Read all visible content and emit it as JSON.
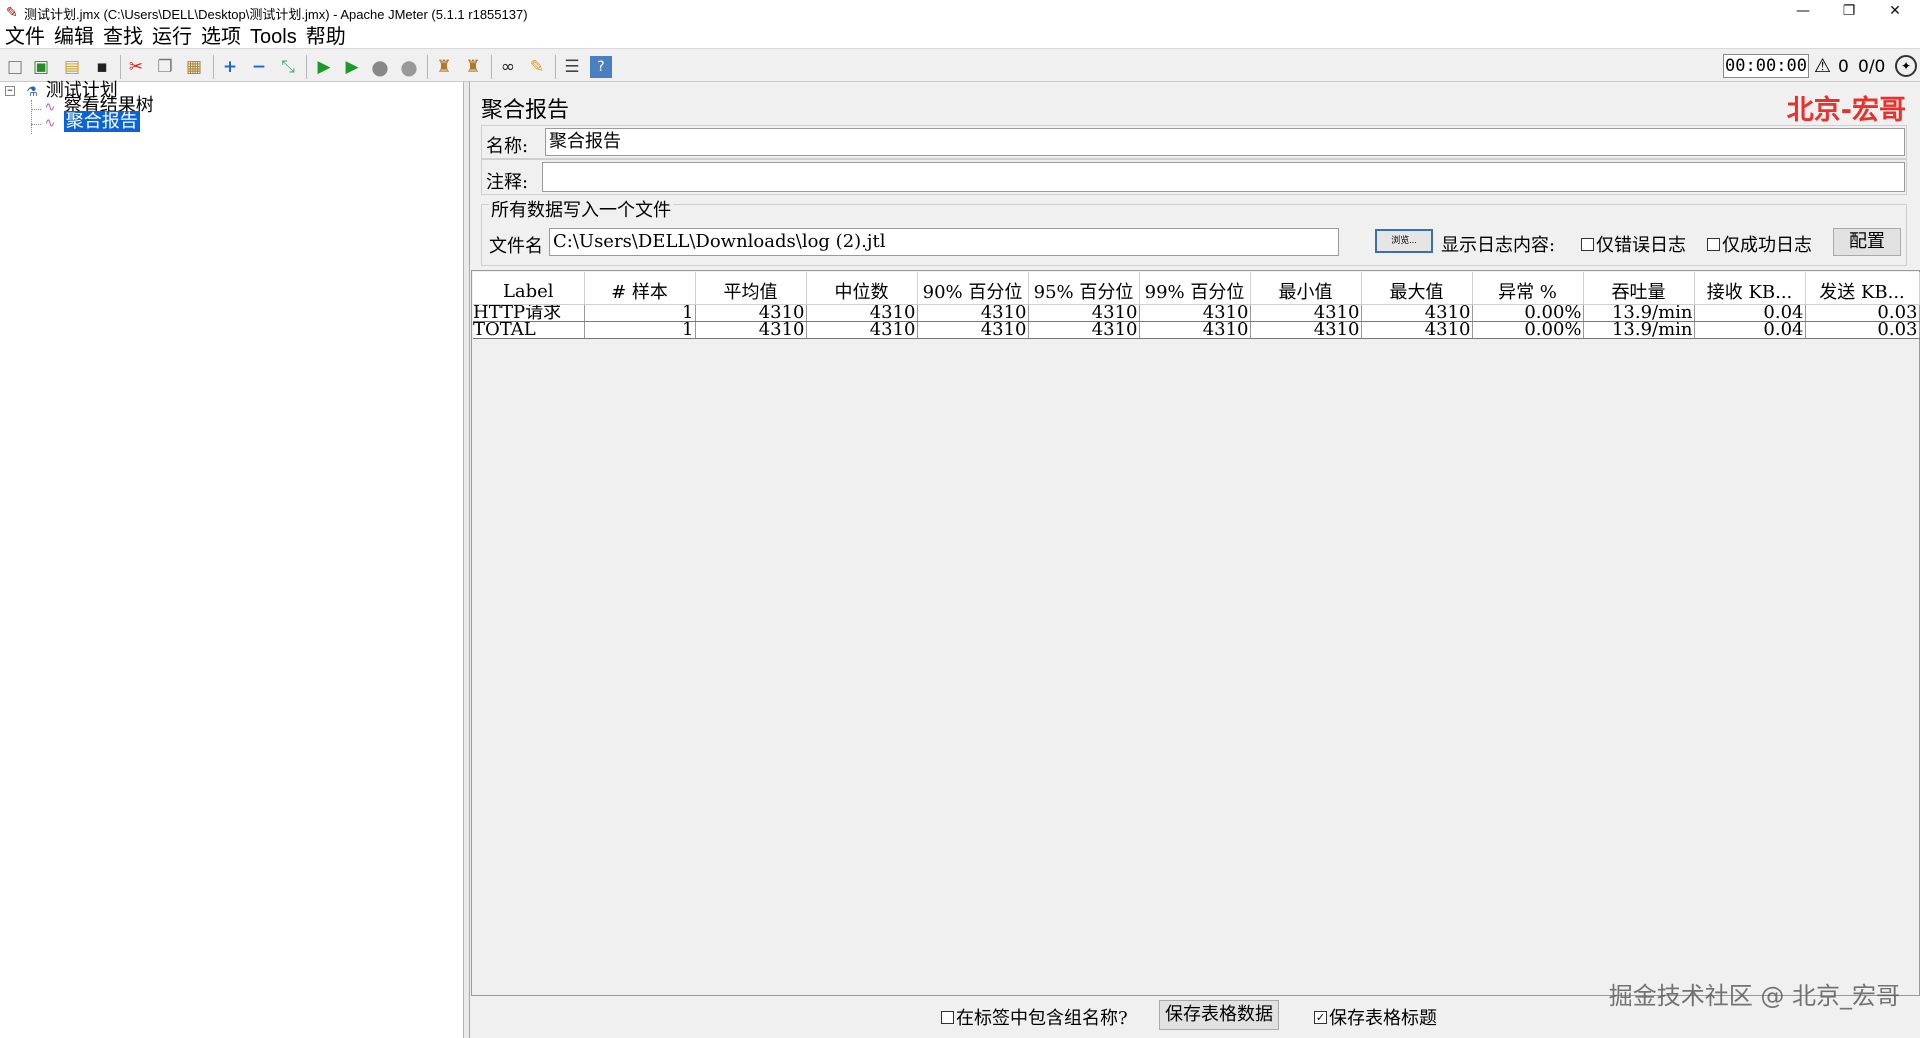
{
  "window": {
    "title": "测试计划.jmx (C:\\Users\\DELL\\Desktop\\测试计划.jmx) - Apache JMeter (5.1.1 r1855137)",
    "minimize": "—",
    "maximize": "❐",
    "close": "✕"
  },
  "menu": [
    "文件",
    "编辑",
    "查找",
    "运行",
    "选项",
    "Tools",
    "帮助"
  ],
  "toolbar": {
    "elapsed": "00:00:00",
    "error_count": "0",
    "threads": "0/0"
  },
  "tree": {
    "root": "测试计划",
    "children": [
      "察看结果树",
      "聚合报告"
    ],
    "selected": "聚合报告"
  },
  "panel": {
    "heading": "聚合报告",
    "brand": "北京-宏哥",
    "name_label": "名称:",
    "name_value": "聚合报告",
    "comment_label": "注释:",
    "comment_value": "",
    "file_group_title": "所有数据写入一个文件",
    "file_label": "文件名",
    "file_value": "C:\\Users\\DELL\\Downloads\\log (2).jtl",
    "browse_label": "浏览...",
    "log_display_label": "显示日志内容:",
    "errors_only_label": "仅错误日志",
    "success_only_label": "仅成功日志",
    "configure_label": "配置"
  },
  "table": {
    "columns": [
      "Label",
      "# 样本",
      "平均值",
      "中位数",
      "90% 百分位",
      "95% 百分位",
      "99% 百分位",
      "最小值",
      "最大值",
      "异常 %",
      "吞吐量",
      "接收 KB...",
      "发送 KB..."
    ],
    "rows": [
      [
        "HTTP请求",
        "1",
        "4310",
        "4310",
        "4310",
        "4310",
        "4310",
        "4310",
        "4310",
        "0.00%",
        "13.9/min",
        "0.04",
        "0.03"
      ],
      [
        "TOTAL",
        "1",
        "4310",
        "4310",
        "4310",
        "4310",
        "4310",
        "4310",
        "4310",
        "0.00%",
        "13.9/min",
        "0.04",
        "0.03"
      ]
    ]
  },
  "bottom": {
    "include_group_label": "在标签中包含组名称?",
    "include_group_checked": false,
    "save_table_label": "保存表格数据",
    "save_header_label": "保存表格标题",
    "save_header_checked": true
  },
  "watermark": "掘金技术社区 @ 北京_宏哥",
  "icons": [
    "new-icon",
    "templates-icon",
    "open-icon",
    "save-icon",
    "cut-icon",
    "copy-icon",
    "paste-icon",
    "expand-icon",
    "collapse-icon",
    "toggle-icon",
    "start-icon",
    "start-no-timers-icon",
    "stop-icon",
    "shutdown-icon",
    "clear-icon",
    "clear-all-icon",
    "search-icon",
    "reset-search-icon",
    "function-helper-icon",
    "help-icon",
    "warning-icon",
    "remote-icon"
  ],
  "colors": {
    "selection": "#0a64d6",
    "brand": "#e8312b"
  }
}
